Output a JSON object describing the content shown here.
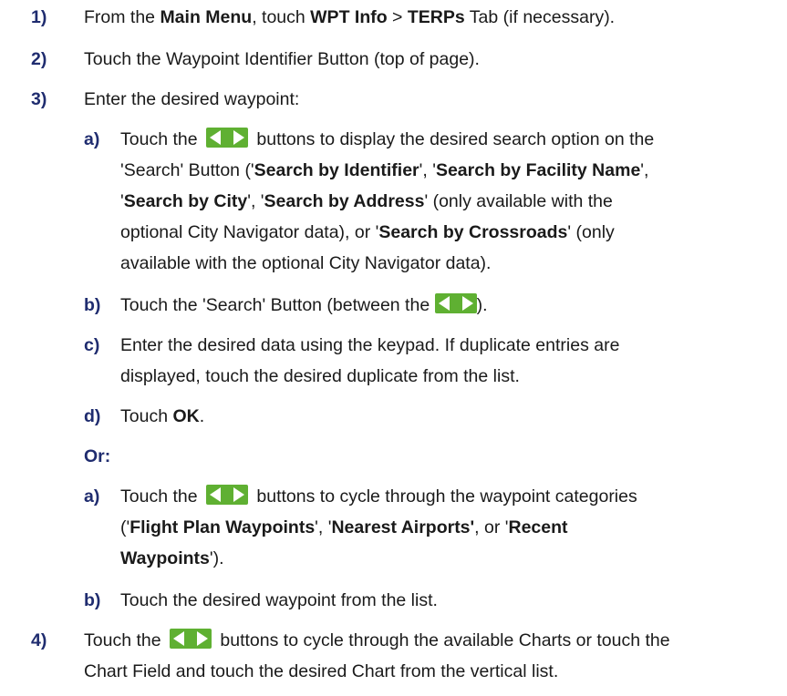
{
  "steps": {
    "s1": {
      "num": "1)",
      "p1": "From the ",
      "b1": "Main Menu",
      "p2": ", touch ",
      "b2": "WPT Info",
      "p3": " > ",
      "b3": "TERPs",
      "p4": " Tab (if necessary).",
      "colors": {
        "text": "#1a1a1a"
      }
    },
    "s2": {
      "num": "2)",
      "text": "Touch the Waypoint Identifier Button (top of page)."
    },
    "s3": {
      "num": "3)",
      "text": "Enter the desired waypoint:",
      "a": {
        "label": "a)",
        "l1a": "Touch the ",
        "l1b": " buttons to display the desired search option on the",
        "l2a": "'Search' Button ('",
        "l2b": "Search by Identifier",
        "l2c": "', '",
        "l2d": "Search by Facility Name",
        "l2e": "',",
        "l3a": "'",
        "l3b": "Search by City",
        "l3c": "',  '",
        "l3d": "Search by Address",
        "l3e": "' (only available with the",
        "l4a": "optional City Navigator data), or '",
        "l4b": "Search by Crossroads",
        "l4c": "' (only",
        "l5": "available with the optional City Navigator data)."
      },
      "b": {
        "label": "b)",
        "l1a": "Touch the 'Search' Button (between the ",
        "l1b": ")."
      },
      "c": {
        "label": "c)",
        "l1": "Enter the desired data using the keypad.  If duplicate entries are",
        "l2": "displayed, touch the desired duplicate from the list."
      },
      "d": {
        "label": "d)",
        "l1a": "Touch ",
        "l1b": "OK",
        "l1c": "."
      },
      "or": "Or:",
      "a2": {
        "label": "a)",
        "l1a": "Touch the ",
        "l1b": " buttons to cycle through the waypoint categories",
        "l2a": "('",
        "l2b": "Flight Plan Waypoints",
        "l2c": "', '",
        "l2d": "Nearest Airports'",
        "l2e": ", or '",
        "l2f": "Recent",
        "l3a": "Waypoints",
        "l3b": "')."
      },
      "b2": {
        "label": "b)",
        "l1": "Touch the desired waypoint from the list."
      }
    },
    "s4": {
      "num": "4)",
      "l1a": "Touch the ",
      "l1b": " buttons to cycle through the available Charts or touch the",
      "l2": "Chart Field and touch the desired Chart from the vertical list."
    }
  },
  "icons": {
    "arrows": "left-right-arrow-buttons-icon",
    "arrow_color": "#5fb032",
    "arrow_fill": "#ffffff"
  },
  "colors": {
    "step_number": "#1f2c6f",
    "text": "#1a1a1a"
  }
}
